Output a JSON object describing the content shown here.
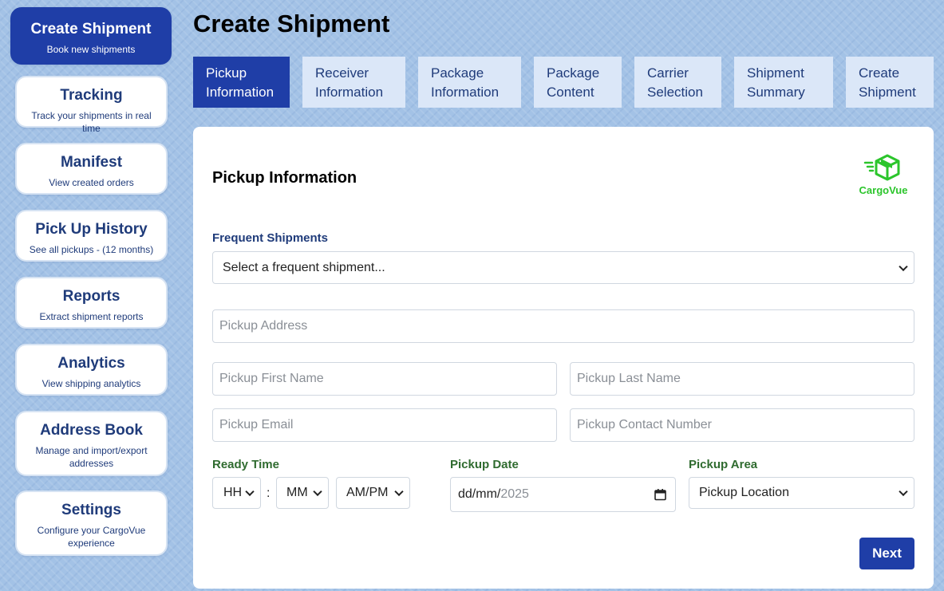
{
  "sidebar": {
    "items": [
      {
        "title": "Create Shipment",
        "sub": "Book new shipments"
      },
      {
        "title": "Tracking",
        "sub": "Track your shipments in real time"
      },
      {
        "title": "Manifest",
        "sub": "View created orders"
      },
      {
        "title": "Pick Up History",
        "sub": "See all pickups - (12 months)"
      },
      {
        "title": "Reports",
        "sub": "Extract shipment reports"
      },
      {
        "title": "Analytics",
        "sub": "View shipping analytics"
      },
      {
        "title": "Address Book",
        "sub": "Manage and import/export addresses"
      },
      {
        "title": "Settings",
        "sub": "Configure your CargoVue experience"
      }
    ]
  },
  "page": {
    "title": "Create Shipment"
  },
  "tabs": [
    {
      "line1": "Pickup",
      "line2": "Information"
    },
    {
      "line1": "Receiver",
      "line2": "Information"
    },
    {
      "line1": "Package",
      "line2": "Information"
    },
    {
      "line1": "Package",
      "line2": "Content"
    },
    {
      "line1": "Carrier",
      "line2": "Selection"
    },
    {
      "line1": "Shipment",
      "line2": "Summary"
    },
    {
      "line1": "Create",
      "line2": "Shipment"
    }
  ],
  "panel": {
    "title": "Pickup Information",
    "logo_text": "CargoVue"
  },
  "form": {
    "frequent_label": "Frequent Shipments",
    "frequent_value": "Select a frequent shipment...",
    "address_placeholder": "Pickup Address",
    "first_name_placeholder": "Pickup First Name",
    "last_name_placeholder": "Pickup Last Name",
    "email_placeholder": "Pickup Email",
    "contact_placeholder": "Pickup Contact Number",
    "ready_time_label": "Ready Time",
    "hh_value": "HH",
    "colon": ":",
    "mm_value": "MM",
    "ampm_value": "AM/PM",
    "pickup_date_label": "Pickup Date",
    "date_dd_mm": "dd/mm/",
    "date_year": "2025",
    "pickup_area_label": "Pickup Area",
    "pickup_area_value": "Pickup Location",
    "next_label": "Next"
  },
  "colors": {
    "accent": "#1f3ea7",
    "tab_inactive": "#dbe7f8",
    "label_green": "#2f6b2f",
    "logo_green": "#2cc52c"
  }
}
